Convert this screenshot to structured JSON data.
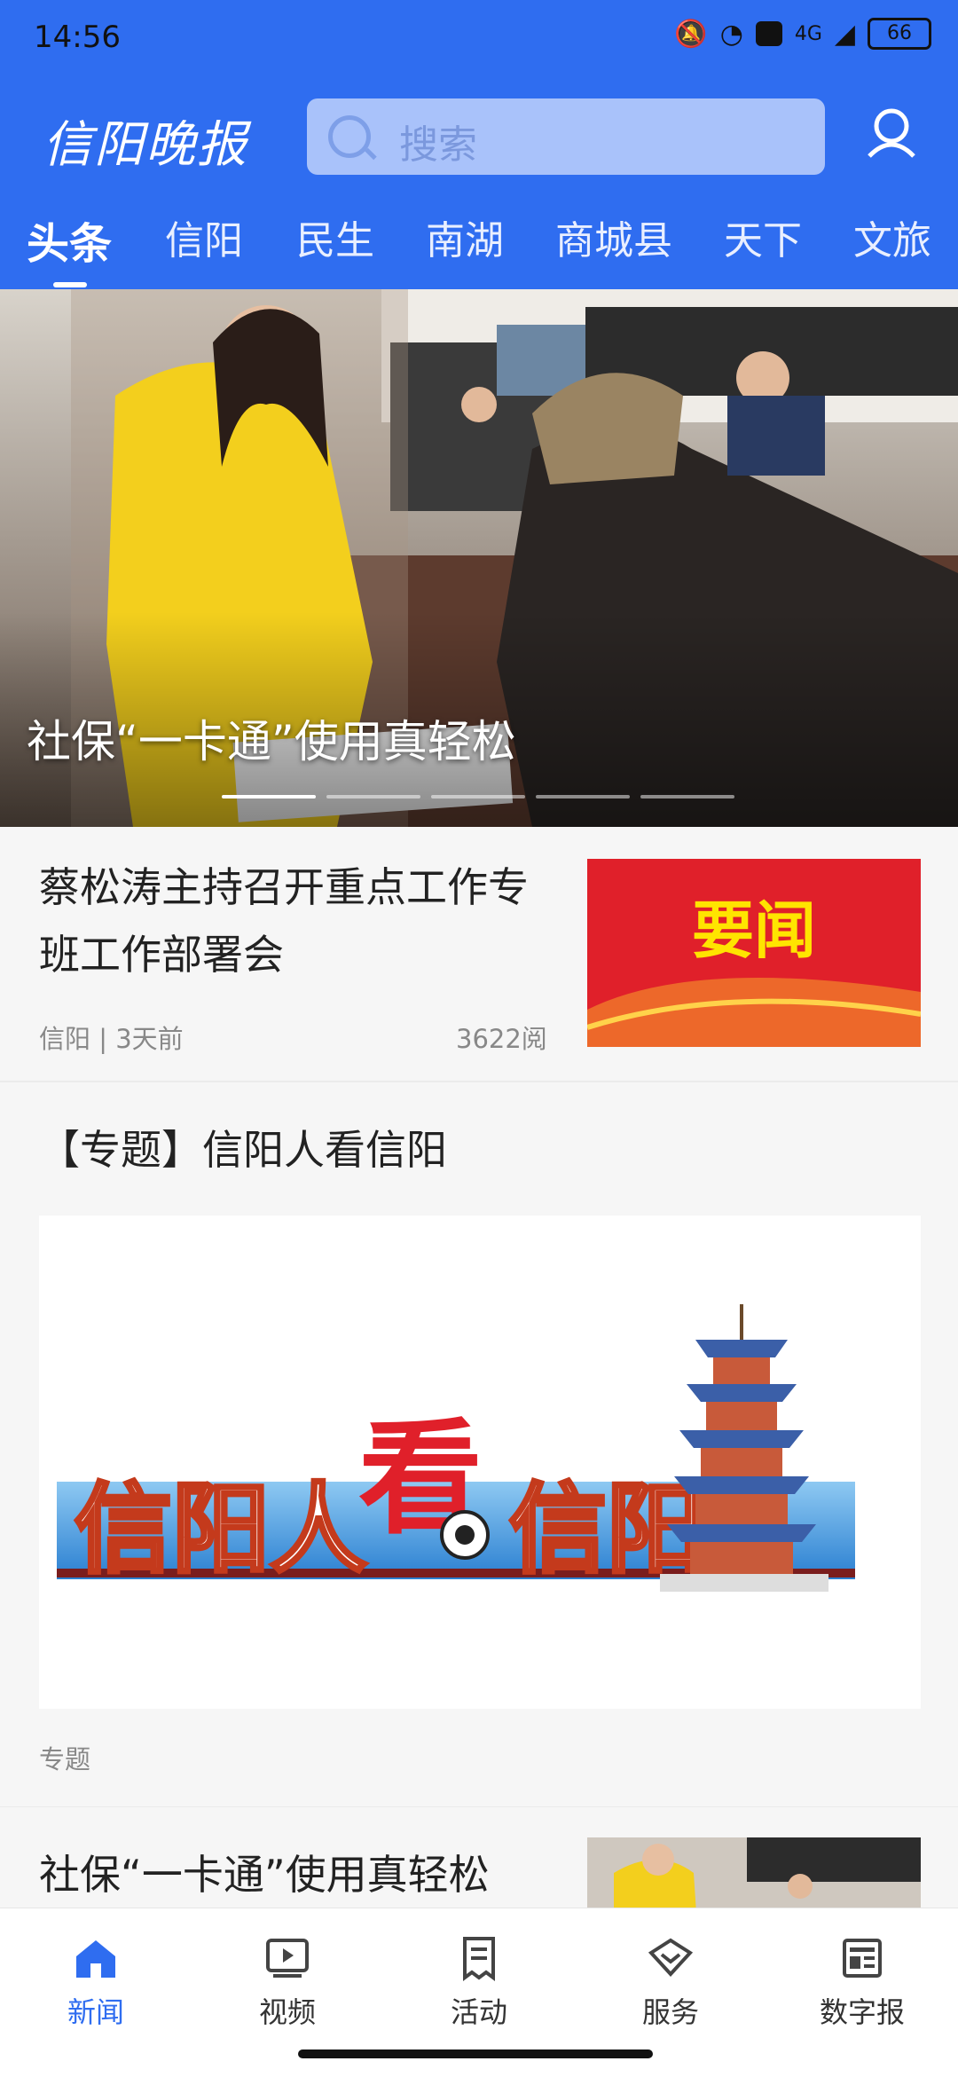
{
  "status_bar": {
    "time": "14:56",
    "network": "4G",
    "battery": "66"
  },
  "header": {
    "logo_text": "信阳晚报",
    "search_placeholder": "搜索",
    "tabs": [
      "头条",
      "信阳",
      "民生",
      "南湖",
      "商城县",
      "天下",
      "文旅"
    ],
    "active_tab": 0
  },
  "banner": {
    "caption": "社保“一卡通”使用真轻松",
    "slide_count": 5,
    "active_slide": 0
  },
  "feed": [
    {
      "title": "蔡松涛主持召开重点工作专班工作部署会",
      "source": "信阳 | 3天前",
      "reads": "3622阅",
      "thumb_text": "要闻"
    },
    {
      "title": "【专题】信阳人看信阳",
      "banner_text": [
        "信阳人",
        "看",
        "信阳"
      ],
      "tag": "专题"
    },
    {
      "title": "社保“一卡通”使用真轻松"
    }
  ],
  "bottom_nav": [
    {
      "label": "新闻",
      "icon": "home-icon",
      "active": true
    },
    {
      "label": "视频",
      "icon": "video-icon",
      "active": false
    },
    {
      "label": "活动",
      "icon": "activity-icon",
      "active": false
    },
    {
      "label": "服务",
      "icon": "service-icon",
      "active": false
    },
    {
      "label": "数字报",
      "icon": "newspaper-icon",
      "active": false
    }
  ],
  "colors": {
    "brand_blue": "#2f6df0",
    "news_red": "#e0202a",
    "headline_yellow": "#ffe400"
  }
}
